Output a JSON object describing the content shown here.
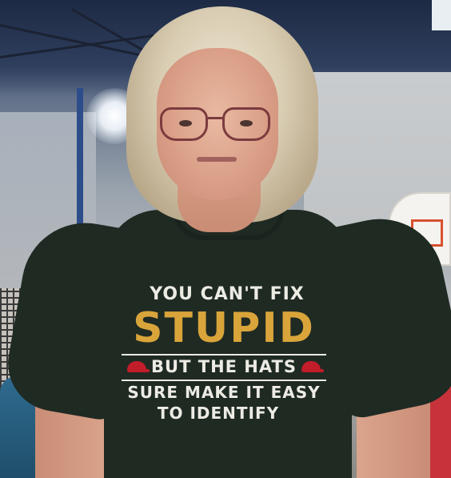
{
  "photo": {
    "subject": "woman-in-tshirt",
    "setting": "gymnasium-with-basketball-hoop"
  },
  "tshirt": {
    "line1": "YOU CAN'T FIX",
    "line2": "STUPID",
    "line3": "BUT THE HATS",
    "line4": "SURE MAKE IT EASY",
    "line5": "TO IDENTIFY",
    "colors": {
      "shirt": "#1f2a23",
      "accent_text": "#d9a43a",
      "main_text": "#ecece4",
      "hat_icon": "#c21d2b"
    }
  }
}
